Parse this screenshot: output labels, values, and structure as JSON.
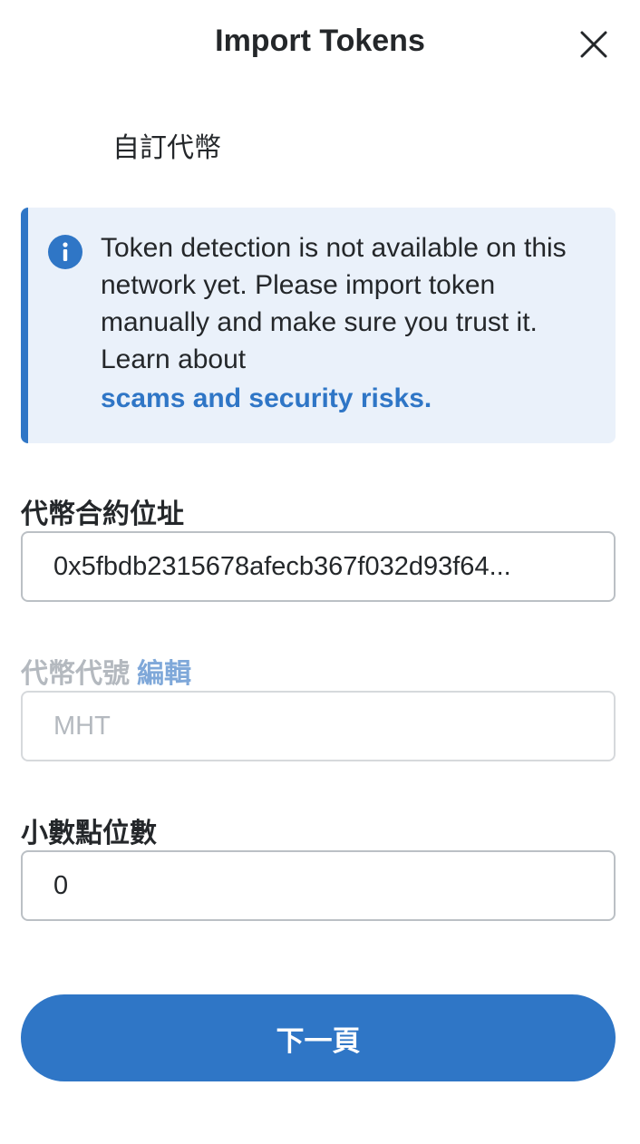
{
  "header": {
    "title": "Import Tokens",
    "close_icon": "close-icon"
  },
  "tabs": {
    "custom_token_label": "自訂代幣"
  },
  "banner": {
    "icon": "info-icon",
    "message": "Token detection is not available on this network yet. Please import token manually and make sure you trust it. Learn about",
    "link_text": "scams and security risks.",
    "accent_color": "#2f76c6",
    "background_color": "#eaf1fa"
  },
  "form": {
    "contract_address": {
      "label": "代幣合約位址",
      "value": "0x5fbdb2315678afecb367f032d93f64..."
    },
    "token_symbol": {
      "label": "代幣代號",
      "edit_label": "編輯",
      "value": "MHT"
    },
    "decimals": {
      "label": "小數點位數",
      "value": "0"
    }
  },
  "footer": {
    "next_button_label": "下一頁",
    "button_color": "#2f76c6"
  }
}
